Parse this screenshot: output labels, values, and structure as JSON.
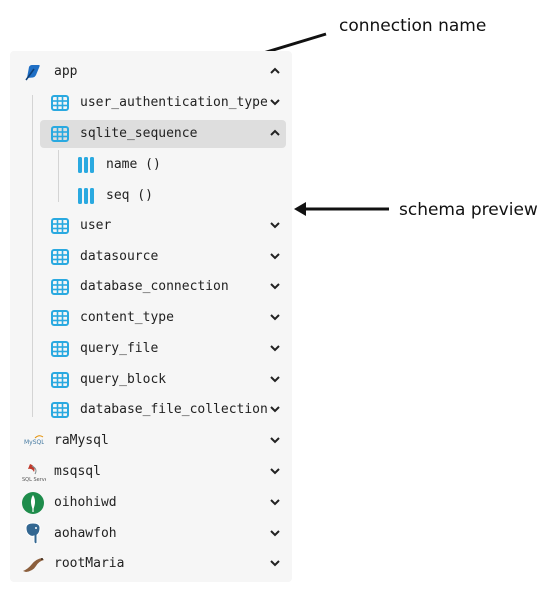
{
  "annotations": {
    "connection_name": "connection name",
    "schema_preview": "schema preview"
  },
  "tree": {
    "root": {
      "label": "app",
      "icon": "sqlite-feather-icon",
      "expanded": true
    },
    "tables": [
      {
        "label": "user_authentication_type",
        "expanded": false
      },
      {
        "label": "sqlite_sequence",
        "expanded": true,
        "selected": true,
        "columns": [
          {
            "label": "name ()"
          },
          {
            "label": "seq ()"
          }
        ]
      },
      {
        "label": "user",
        "expanded": false
      },
      {
        "label": "datasource",
        "expanded": false
      },
      {
        "label": "database_connection",
        "expanded": false
      },
      {
        "label": "content_type",
        "expanded": false
      },
      {
        "label": "query_file",
        "expanded": false
      },
      {
        "label": "query_block",
        "expanded": false
      },
      {
        "label": "database_file_collection",
        "expanded": false
      }
    ],
    "connections": [
      {
        "label": "raMysql",
        "icon": "mysql-logo-icon"
      },
      {
        "label": "msqsql",
        "icon": "sql-server-logo-icon"
      },
      {
        "label": "oihohiwd",
        "icon": "mongodb-leaf-icon"
      },
      {
        "label": "aohawfoh",
        "icon": "postgresql-elephant-icon"
      },
      {
        "label": "rootMaria",
        "icon": "mariadb-seal-icon"
      }
    ]
  },
  "colors": {
    "table_icon": "#2aa9e0",
    "column_icon": "#2aa9e0",
    "selected_row": "#dedede",
    "panel_bg": "#f6f6f6"
  }
}
